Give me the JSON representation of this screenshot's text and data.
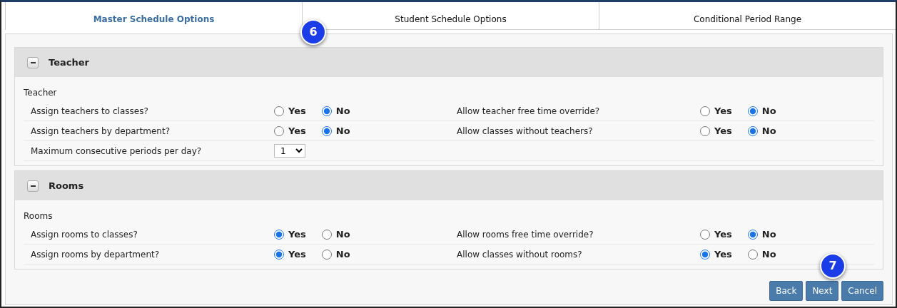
{
  "tabs": [
    {
      "label": "Master Schedule Options",
      "selected": true
    },
    {
      "label": "Student Schedule Options",
      "selected": false
    },
    {
      "label": "Conditional Period Range",
      "selected": false
    }
  ],
  "sections": [
    {
      "title": "Teacher",
      "expanded": true,
      "subtitle": "Teacher",
      "rows": [
        [
          {
            "question": "Assign teachers to classes?",
            "kind": "radio",
            "options": [
              {
                "label": "Yes",
                "selected": false
              },
              {
                "label": "No",
                "selected": true
              }
            ]
          },
          {
            "question": "Allow teacher free time override?",
            "kind": "radio",
            "options": [
              {
                "label": "Yes",
                "selected": false
              },
              {
                "label": "No",
                "selected": true
              }
            ]
          }
        ],
        [
          {
            "question": "Assign teachers by department?",
            "kind": "radio",
            "options": [
              {
                "label": "Yes",
                "selected": false
              },
              {
                "label": "No",
                "selected": true
              }
            ]
          },
          {
            "question": "Allow classes without teachers?",
            "kind": "radio",
            "options": [
              {
                "label": "Yes",
                "selected": false
              },
              {
                "label": "No",
                "selected": true
              }
            ]
          }
        ],
        [
          {
            "question": "Maximum consecutive periods per day?",
            "kind": "select",
            "value": "1"
          }
        ]
      ]
    },
    {
      "title": "Rooms",
      "expanded": true,
      "subtitle": "Rooms",
      "rows": [
        [
          {
            "question": "Assign rooms to classes?",
            "kind": "radio",
            "options": [
              {
                "label": "Yes",
                "selected": true
              },
              {
                "label": "No",
                "selected": false
              }
            ]
          },
          {
            "question": "Allow rooms free time override?",
            "kind": "radio",
            "options": [
              {
                "label": "Yes",
                "selected": false
              },
              {
                "label": "No",
                "selected": true
              }
            ]
          }
        ],
        [
          {
            "question": "Assign rooms by department?",
            "kind": "radio",
            "options": [
              {
                "label": "Yes",
                "selected": true
              },
              {
                "label": "No",
                "selected": false
              }
            ]
          },
          {
            "question": "Allow classes without rooms?",
            "kind": "radio",
            "options": [
              {
                "label": "Yes",
                "selected": true
              },
              {
                "label": "No",
                "selected": false
              }
            ]
          }
        ]
      ]
    }
  ],
  "buttons": [
    "Back",
    "Next",
    "Cancel"
  ],
  "callouts": [
    {
      "label": "6"
    },
    {
      "label": "7"
    }
  ]
}
